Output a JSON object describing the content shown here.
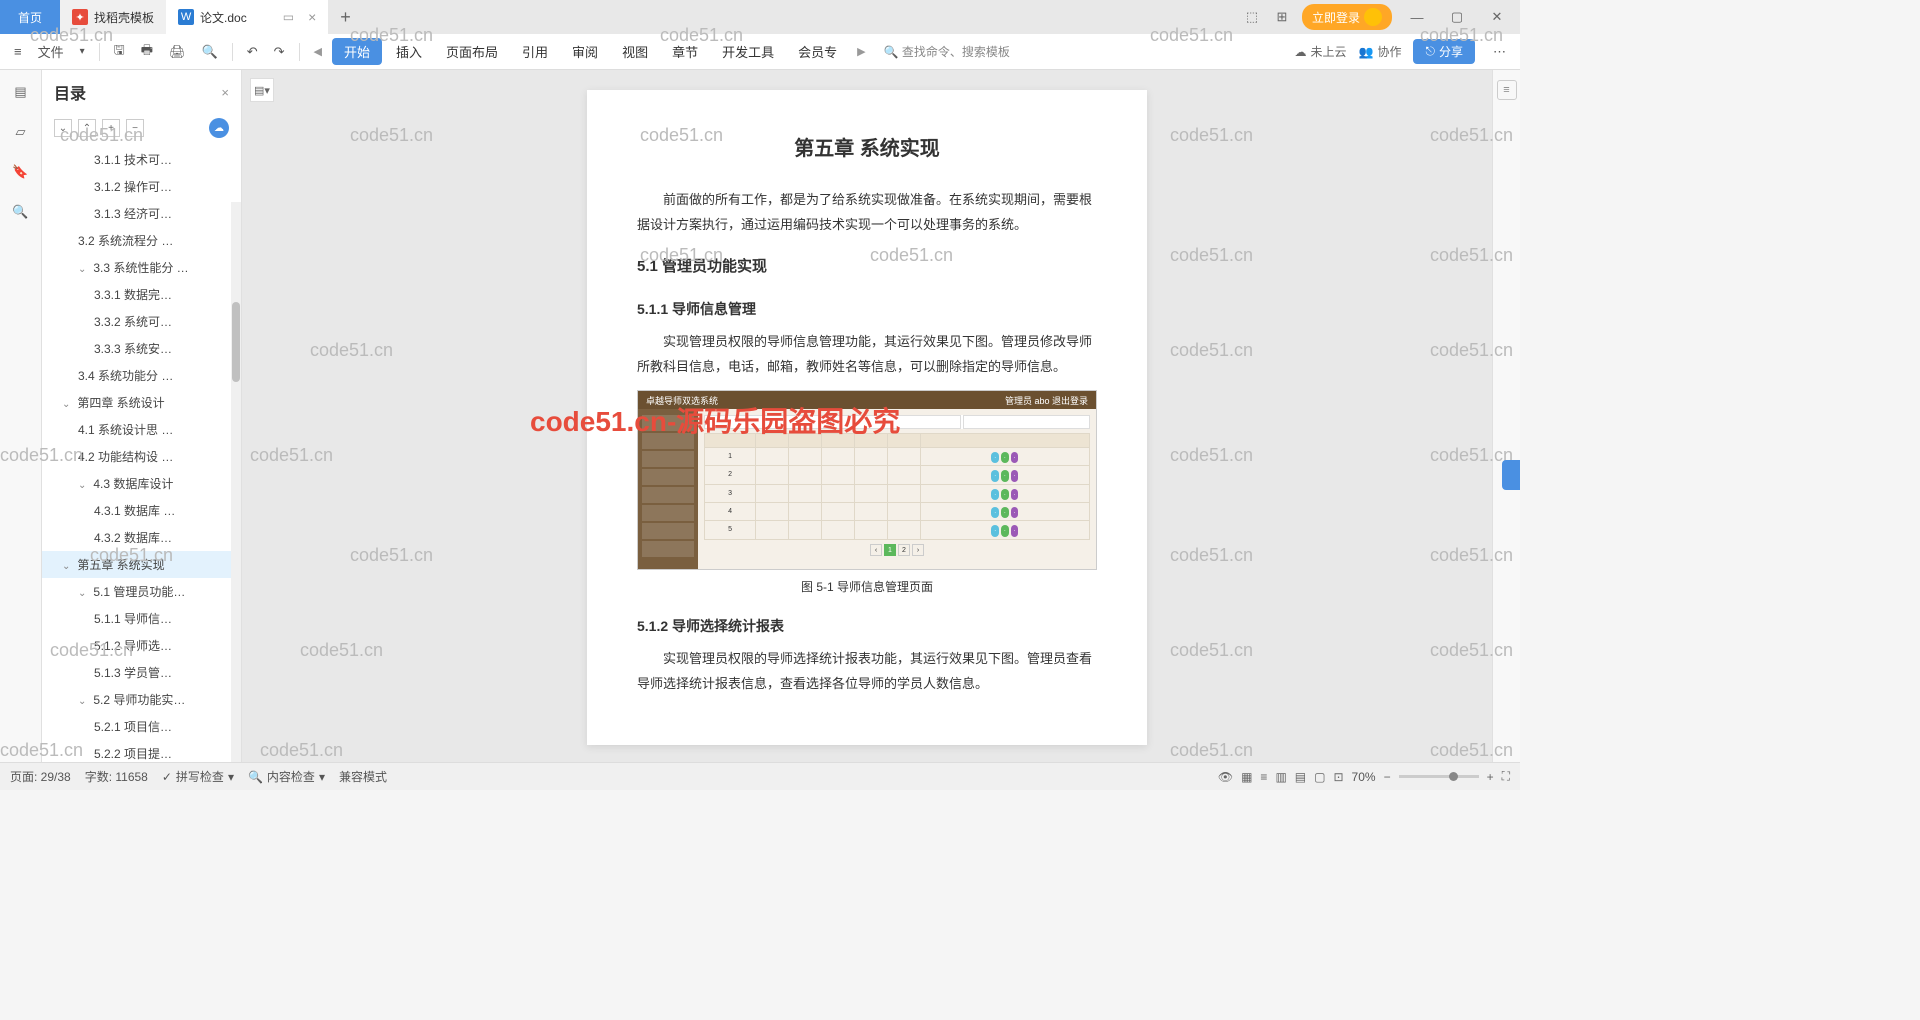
{
  "titlebar": {
    "home": "首页",
    "template_tab": "找稻壳模板",
    "doc_tab": "论文.doc",
    "login": "立即登录"
  },
  "ribbon": {
    "file": "文件",
    "tabs": [
      "开始",
      "插入",
      "页面布局",
      "引用",
      "审阅",
      "视图",
      "章节",
      "开发工具",
      "会员专"
    ],
    "search": "查找命令、搜索模板",
    "cloud": "未上云",
    "collab": "协作",
    "share": "分享"
  },
  "outline": {
    "title": "目录",
    "items": [
      {
        "pad": 52,
        "text": "3.1.1 技术可…"
      },
      {
        "pad": 52,
        "text": "3.1.2 操作可…"
      },
      {
        "pad": 52,
        "text": "3.1.3 经济可…"
      },
      {
        "pad": 36,
        "text": "3.2 系统流程分 …"
      },
      {
        "pad": 36,
        "text": "3.3 系统性能分 …",
        "chev": "⌄"
      },
      {
        "pad": 52,
        "text": "3.3.1 数据完…"
      },
      {
        "pad": 52,
        "text": "3.3.2 系统可…"
      },
      {
        "pad": 52,
        "text": "3.3.3 系统安…"
      },
      {
        "pad": 36,
        "text": "3.4 系统功能分 …"
      },
      {
        "pad": 20,
        "text": "第四章  系统设计",
        "chev": "⌄"
      },
      {
        "pad": 36,
        "text": "4.1 系统设计思 …"
      },
      {
        "pad": 36,
        "text": "4.2 功能结构设 …"
      },
      {
        "pad": 36,
        "text": "4.3 数据库设计",
        "chev": "⌄"
      },
      {
        "pad": 52,
        "text": "4.3.1 数据库 …"
      },
      {
        "pad": 52,
        "text": "4.3.2 数据库…"
      },
      {
        "pad": 20,
        "text": "第五章  系统实现",
        "chev": "⌄",
        "active": true
      },
      {
        "pad": 36,
        "text": "5.1 管理员功能…",
        "chev": "⌄"
      },
      {
        "pad": 52,
        "text": "5.1.1 导师信…"
      },
      {
        "pad": 52,
        "text": "5.1.2 导师选…"
      },
      {
        "pad": 52,
        "text": "5.1.3 学员管…"
      },
      {
        "pad": 36,
        "text": "5.2 导师功能实…",
        "chev": "⌄"
      },
      {
        "pad": 52,
        "text": "5.2.1 项目信…"
      },
      {
        "pad": 52,
        "text": "5.2.2 项目提…"
      }
    ]
  },
  "doc": {
    "h1": "第五章  系统实现",
    "p1": "前面做的所有工作，都是为了给系统实现做准备。在系统实现期间，需要根据设计方案执行，通过运用编码技术实现一个可以处理事务的系统。",
    "h2_1": "5.1 管理员功能实现",
    "h3_1": "5.1.1 导师信息管理",
    "p2": "实现管理员权限的导师信息管理功能，其运行效果见下图。管理员修改导师所教科目信息，电话，邮箱，教师姓名等信息，可以删除指定的导师信息。",
    "fig_sys_title": "卓越导师双选系统",
    "fig_sys_user": "管理员 abo  退出登录",
    "fig_caption": "图 5-1 导师信息管理页面",
    "h3_2": "5.1.2 导师选择统计报表",
    "p3": "实现管理员权限的导师选择统计报表功能，其运行效果见下图。管理员查看导师选择统计报表信息，查看选择各位导师的学员人数信息。"
  },
  "status": {
    "page": "页面: 29/38",
    "words": "字数: 11658",
    "spell": "拼写检查",
    "content": "内容检查",
    "compat": "兼容模式",
    "zoom": "70%"
  },
  "watermark": "code51.cn",
  "watermark_red": "code51.cn-源码乐园盗图必究"
}
